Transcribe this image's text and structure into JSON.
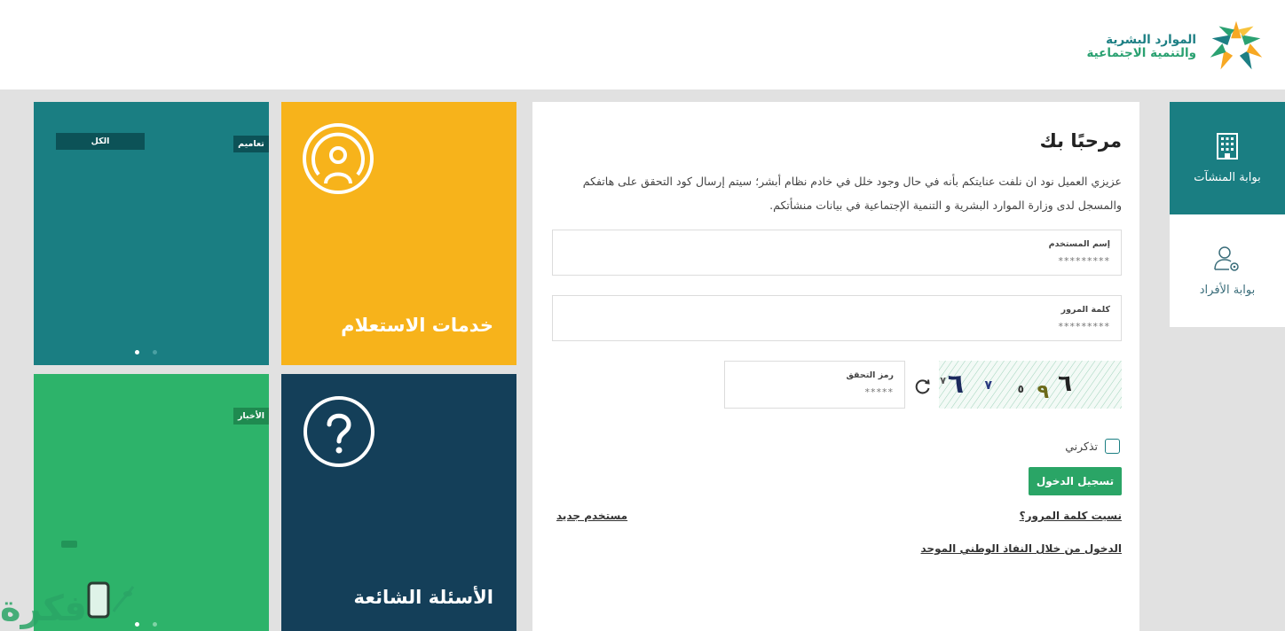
{
  "header": {
    "logo_line1": "الموارد البشرية",
    "logo_line2": "والتنمية الاجتماعية",
    "logo_icon": "ministry-star-logo"
  },
  "portals": [
    {
      "label": "بوابة المنشآت",
      "icon": "building-icon",
      "active": true
    },
    {
      "label": "بوابة الأفراد",
      "icon": "user-gear-icon",
      "active": false
    }
  ],
  "login": {
    "title": "مرحبًا بك",
    "intro": "عزيزي العميل نود ان نلفت عنايتكم بأنه في حال وجود خلل في خادم نظام أبشر؛ سيتم إرسال كود التحقق على هاتفكم والمسجل لدى وزارة الموارد البشرية و التنمية الإجتماعية في بيانات منشأتكم.",
    "username_label": "إسم المستخدم",
    "username_placeholder": "*********",
    "password_label": "كلمة المرور",
    "password_placeholder": "*********",
    "captcha_label": "رمز التحقق",
    "captcha_placeholder": "*****",
    "captcha_text": "٦ ٩ ٥ ٧ ٦ ٧",
    "remember_label": "تذكرني",
    "login_button": "تسجيل الدخول",
    "forgot_password": "نسيت كلمة المرور؟",
    "new_user": "مستخدم جديد",
    "nafath_login": "الدخول من خلال النفاذ الوطني الموحد"
  },
  "tiles": {
    "news_tile": {
      "tab_all": "الكل",
      "tab_circulars": "تعاميم",
      "slides": 2,
      "active_slide": 1
    },
    "inquiry_tile": {
      "title": "خدمات الاستعلام",
      "icon": "broadcast-user-icon"
    },
    "news2_tile": {
      "tab_news": "الأخبار"
    },
    "faq_tile": {
      "title": "الأسئلة الشائعة",
      "icon": "question-circle-icon"
    }
  },
  "watermark": {
    "text": "فكرة"
  },
  "colors": {
    "teal": "#1a7e82",
    "yellow": "#f7b31b",
    "green": "#2db36a",
    "navy": "#143f59",
    "button_green": "#2aa566"
  }
}
